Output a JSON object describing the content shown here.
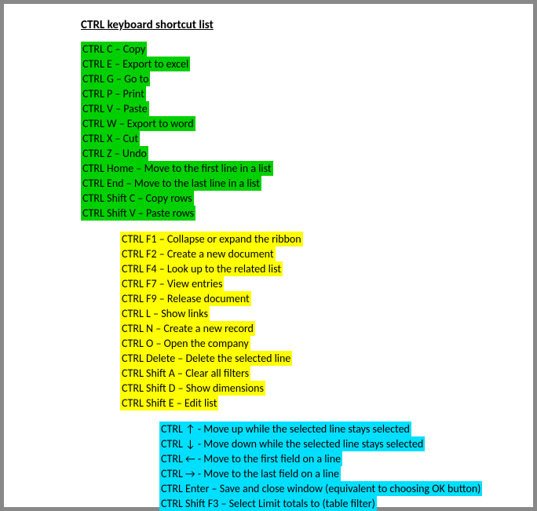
{
  "title": "CTRL keyboard shortcut list",
  "groups": [
    {
      "color": "green",
      "items": [
        "CTRL C – Copy",
        "CTRL E – Export to excel",
        "CTRL G – Go to",
        "CTRL P – Print",
        "CTRL V – Paste",
        "CTRL W – Export to word",
        "CTRL X – Cut",
        "CTRL Z – Undo",
        "CTRL Home – Move to the first line in a list",
        "CTRL End – Move to the last line in a list",
        "CTRL Shift C – Copy rows",
        "CTRL Shift V – Paste rows"
      ]
    },
    {
      "color": "yellow",
      "items": [
        "CTRL F1 – Collapse or expand the ribbon",
        "CTRL F2 – Create a new document",
        "CTRL F4 – Look up to the related list",
        "CTRL F7 – View entries",
        "CTRL F9 – Release document",
        "CTRL L – Show links",
        "CTRL N – Create a new record",
        "CTRL O – Open the company",
        "CTRL Delete – Delete the selected line",
        "CTRL Shift A – Clear all filters",
        "CTRL Shift D – Show dimensions",
        "CTRL Shift E – Edit list"
      ]
    },
    {
      "color": "cyan",
      "items": [
        "CTRL ↑ - Move up while the selected line stays selected",
        "CTRL ↓ - Move down while the selected line stays selected",
        "CTRL ← - Move to the first field on a line",
        "CTRL → - Move to the last field on a line",
        "CTRL Enter – Save and close window (equivalent to choosing OK button)",
        "CTRL Shift F3 – Select Limit totals to (table filter)"
      ]
    }
  ]
}
